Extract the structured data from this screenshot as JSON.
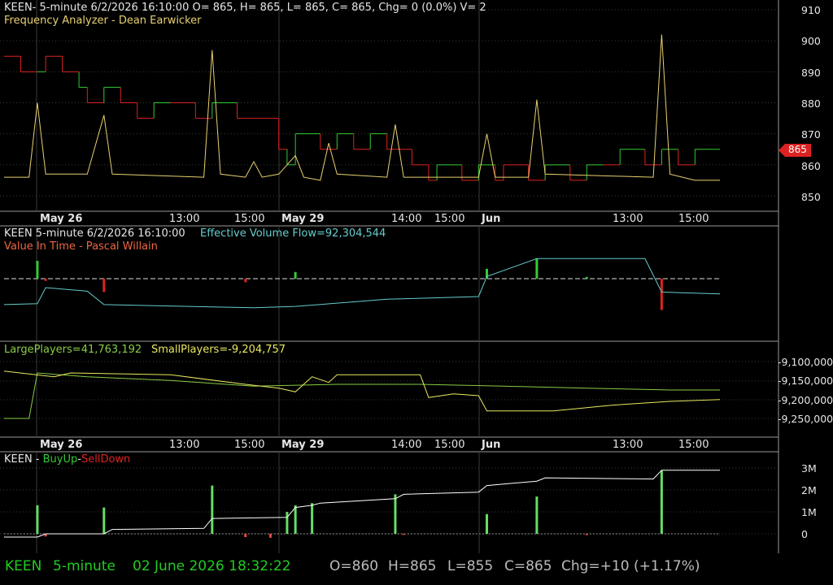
{
  "colors": {
    "background": "#000000",
    "grid": "#3a3a3a",
    "axis_text": "#e6e6e6",
    "up": "#33cc33",
    "down": "#dd2222",
    "fa_line": "#e8d070",
    "evf_line": "#66cccc",
    "large_players": "#88cc44",
    "small_players": "#e8e860",
    "buy_sell_line": "#ffffff",
    "price_marker": "#dd2222",
    "status_green": "#22cc22",
    "status_gray": "#bbbbbb"
  },
  "panel1": {
    "header": "KEEN- 5-minute 6/2/2026 16:10:00 O= 865, H= 865, L= 865, C= 865, Chg= 0 (0.0%) V= 2",
    "indicator_title": "Frequency Analyzer - Dean Earwicker"
  },
  "panel2": {
    "header_symbol": "KEEN 5-minute  6/2/2026 16:10:00",
    "evf_label": "Effective Volume Flow=92,304,544",
    "indicator_title": "Value In Time - Pascal Willain"
  },
  "panel3": {
    "large_label": "LargePlayers=41,763,192",
    "small_label": "SmallPlayers=-9,204,757"
  },
  "panel4": {
    "prefix": "KEEN - ",
    "buy_label": "BuyUp",
    "dash": "-",
    "sell_label": "SellDown"
  },
  "time_axis": [
    "May 26",
    "13:00",
    "15:00",
    "May 29",
    "14:00",
    "15:00",
    "Jun",
    "13:00",
    "15:00"
  ],
  "status": {
    "symbol": "KEEN",
    "interval": "5-minute",
    "datetime": "02 June 2026 18:32:22",
    "open": "O=860",
    "high": "H=865",
    "low": "L=855",
    "close": "C=865",
    "change": "Chg=+10 (+1.17%)"
  },
  "chart_data": [
    {
      "type": "line",
      "title": "KEEN 5-minute price with Frequency Analyzer",
      "ylim": [
        843,
        913
      ],
      "y_ticks": [
        "910",
        "900",
        "890",
        "880",
        "870",
        "860",
        "850"
      ],
      "last_price": "865",
      "x_index_range": [
        0,
        88
      ],
      "price_steps": [
        {
          "x": 0,
          "v": 895,
          "c": "down"
        },
        {
          "x": 2,
          "v": 890,
          "c": "down"
        },
        {
          "x": 4,
          "v": 890,
          "c": "up"
        },
        {
          "x": 5,
          "v": 895,
          "c": "down"
        },
        {
          "x": 7,
          "v": 890,
          "c": "down"
        },
        {
          "x": 9,
          "v": 885,
          "c": "up"
        },
        {
          "x": 10,
          "v": 880,
          "c": "down"
        },
        {
          "x": 12,
          "v": 885,
          "c": "up"
        },
        {
          "x": 14,
          "v": 880,
          "c": "down"
        },
        {
          "x": 16,
          "v": 875,
          "c": "down"
        },
        {
          "x": 18,
          "v": 880,
          "c": "up"
        },
        {
          "x": 20,
          "v": 880,
          "c": "down"
        },
        {
          "x": 23,
          "v": 875,
          "c": "down"
        },
        {
          "x": 25,
          "v": 880,
          "c": "up"
        },
        {
          "x": 28,
          "v": 875,
          "c": "down"
        },
        {
          "x": 31,
          "v": 875,
          "c": "down"
        },
        {
          "x": 33,
          "v": 865,
          "c": "down"
        },
        {
          "x": 34,
          "v": 860,
          "c": "up"
        },
        {
          "x": 35,
          "v": 870,
          "c": "up"
        },
        {
          "x": 38,
          "v": 865,
          "c": "down"
        },
        {
          "x": 40,
          "v": 870,
          "c": "up"
        },
        {
          "x": 42,
          "v": 865,
          "c": "down"
        },
        {
          "x": 44,
          "v": 870,
          "c": "up"
        },
        {
          "x": 46,
          "v": 865,
          "c": "down"
        },
        {
          "x": 49,
          "v": 860,
          "c": "down"
        },
        {
          "x": 51,
          "v": 855,
          "c": "down"
        },
        {
          "x": 52,
          "v": 860,
          "c": "up"
        },
        {
          "x": 55,
          "v": 855,
          "c": "down"
        },
        {
          "x": 57,
          "v": 860,
          "c": "up"
        },
        {
          "x": 59,
          "v": 855,
          "c": "down"
        },
        {
          "x": 60,
          "v": 860,
          "c": "down"
        },
        {
          "x": 63,
          "v": 855,
          "c": "down"
        },
        {
          "x": 65,
          "v": 860,
          "c": "up"
        },
        {
          "x": 68,
          "v": 855,
          "c": "down"
        },
        {
          "x": 70,
          "v": 860,
          "c": "up"
        },
        {
          "x": 72,
          "v": 860,
          "c": "down"
        },
        {
          "x": 74,
          "v": 865,
          "c": "up"
        },
        {
          "x": 77,
          "v": 860,
          "c": "down"
        },
        {
          "x": 79,
          "v": 865,
          "c": "up"
        },
        {
          "x": 81,
          "v": 860,
          "c": "down"
        },
        {
          "x": 83,
          "v": 865,
          "c": "up"
        },
        {
          "x": 86,
          "v": 865,
          "c": "down"
        }
      ],
      "frequency_analyzer": [
        [
          0,
          856
        ],
        [
          3,
          856
        ],
        [
          4,
          880
        ],
        [
          5,
          857
        ],
        [
          10,
          857
        ],
        [
          12,
          876
        ],
        [
          13,
          857
        ],
        [
          24,
          856
        ],
        [
          25,
          897
        ],
        [
          26,
          857
        ],
        [
          29,
          856
        ],
        [
          30,
          861
        ],
        [
          31,
          856
        ],
        [
          33,
          857
        ],
        [
          35,
          863
        ],
        [
          36,
          856
        ],
        [
          38,
          855
        ],
        [
          39,
          867
        ],
        [
          40,
          857
        ],
        [
          46,
          856
        ],
        [
          47,
          873
        ],
        [
          48,
          856
        ],
        [
          57,
          856
        ],
        [
          58,
          870
        ],
        [
          59,
          856
        ],
        [
          63,
          856
        ],
        [
          64,
          881
        ],
        [
          65,
          857
        ],
        [
          78,
          856
        ],
        [
          79,
          902
        ],
        [
          80,
          857
        ],
        [
          83,
          855
        ],
        [
          86,
          855
        ]
      ]
    },
    {
      "type": "line",
      "title": "Value In Time",
      "baseline": 0,
      "ylim": [
        -1,
        1
      ],
      "evf": [
        [
          0,
          -0.58
        ],
        [
          4,
          -0.56
        ],
        [
          5,
          -0.2
        ],
        [
          10,
          -0.28
        ],
        [
          12,
          -0.58
        ],
        [
          30,
          -0.65
        ],
        [
          35,
          -0.62
        ],
        [
          46,
          -0.46
        ],
        [
          57,
          -0.4
        ],
        [
          58,
          0.05
        ],
        [
          64,
          0.45
        ],
        [
          77,
          0.45
        ],
        [
          79,
          -0.3
        ],
        [
          86,
          -0.34
        ]
      ],
      "up_bars": [
        [
          4,
          0.4
        ],
        [
          35,
          0.15
        ],
        [
          58,
          0.22
        ],
        [
          64,
          0.45
        ],
        [
          70,
          0.04
        ]
      ],
      "down_bars": [
        [
          5,
          -0.05
        ],
        [
          12,
          -0.3
        ],
        [
          29,
          -0.08
        ],
        [
          79,
          -0.7
        ]
      ]
    },
    {
      "type": "line",
      "title": "LargePlayers and SmallPlayers",
      "ylim": [
        -9280000,
        -9070000
      ],
      "y_ticks": [
        "-9,100,000",
        "-9,150,000",
        "-9,200,000",
        "-9,250,000"
      ],
      "large_players": [
        [
          0,
          -9250000
        ],
        [
          3,
          -9250000
        ],
        [
          4,
          -9130000
        ],
        [
          10,
          -9140000
        ],
        [
          20,
          -9150000
        ],
        [
          30,
          -9165000
        ],
        [
          40,
          -9160000
        ],
        [
          50,
          -9160000
        ],
        [
          60,
          -9165000
        ],
        [
          70,
          -9170000
        ],
        [
          80,
          -9175000
        ],
        [
          86,
          -9175000
        ]
      ],
      "small_players": [
        [
          0,
          -9125000
        ],
        [
          6,
          -9140000
        ],
        [
          8,
          -9130000
        ],
        [
          20,
          -9135000
        ],
        [
          29,
          -9160000
        ],
        [
          33,
          -9170000
        ],
        [
          35,
          -9180000
        ],
        [
          37,
          -9140000
        ],
        [
          39,
          -9155000
        ],
        [
          40,
          -9135000
        ],
        [
          50,
          -9135000
        ],
        [
          51,
          -9195000
        ],
        [
          54,
          -9185000
        ],
        [
          57,
          -9190000
        ],
        [
          58,
          -9230000
        ],
        [
          66,
          -9230000
        ],
        [
          73,
          -9215000
        ],
        [
          80,
          -9205000
        ],
        [
          86,
          -9200000
        ]
      ],
      "series": [
        {
          "name": "LargePlayers"
        },
        {
          "name": "SmallPlayers"
        }
      ]
    },
    {
      "type": "line",
      "title": "BuyUp-SellDown",
      "ylim": [
        -200000,
        3300000
      ],
      "y_ticks": [
        "3M",
        "2M",
        "1M",
        "0"
      ],
      "cumulative": [
        [
          0,
          -150000
        ],
        [
          4,
          -150000
        ],
        [
          5,
          0
        ],
        [
          12,
          0
        ],
        [
          13,
          200000
        ],
        [
          24,
          250000
        ],
        [
          25,
          700000
        ],
        [
          34,
          750000
        ],
        [
          35,
          1200000
        ],
        [
          37,
          1300000
        ],
        [
          38,
          1400000
        ],
        [
          47,
          1600000
        ],
        [
          48,
          1800000
        ],
        [
          57,
          1900000
        ],
        [
          58,
          2200000
        ],
        [
          64,
          2400000
        ],
        [
          65,
          2550000
        ],
        [
          78,
          2500000
        ],
        [
          79,
          2900000
        ],
        [
          86,
          2900000
        ]
      ],
      "buy_bars": [
        [
          4,
          1300000
        ],
        [
          12,
          1200000
        ],
        [
          25,
          2200000
        ],
        [
          34,
          1000000
        ],
        [
          35,
          1300000
        ],
        [
          37,
          1400000
        ],
        [
          47,
          1800000
        ],
        [
          58,
          900000
        ],
        [
          64,
          1700000
        ],
        [
          79,
          2900000
        ]
      ],
      "sell_bars": [
        [
          5,
          -120000
        ],
        [
          29,
          -150000
        ],
        [
          32,
          -180000
        ],
        [
          48,
          -50000
        ],
        [
          70,
          -60000
        ]
      ]
    }
  ]
}
